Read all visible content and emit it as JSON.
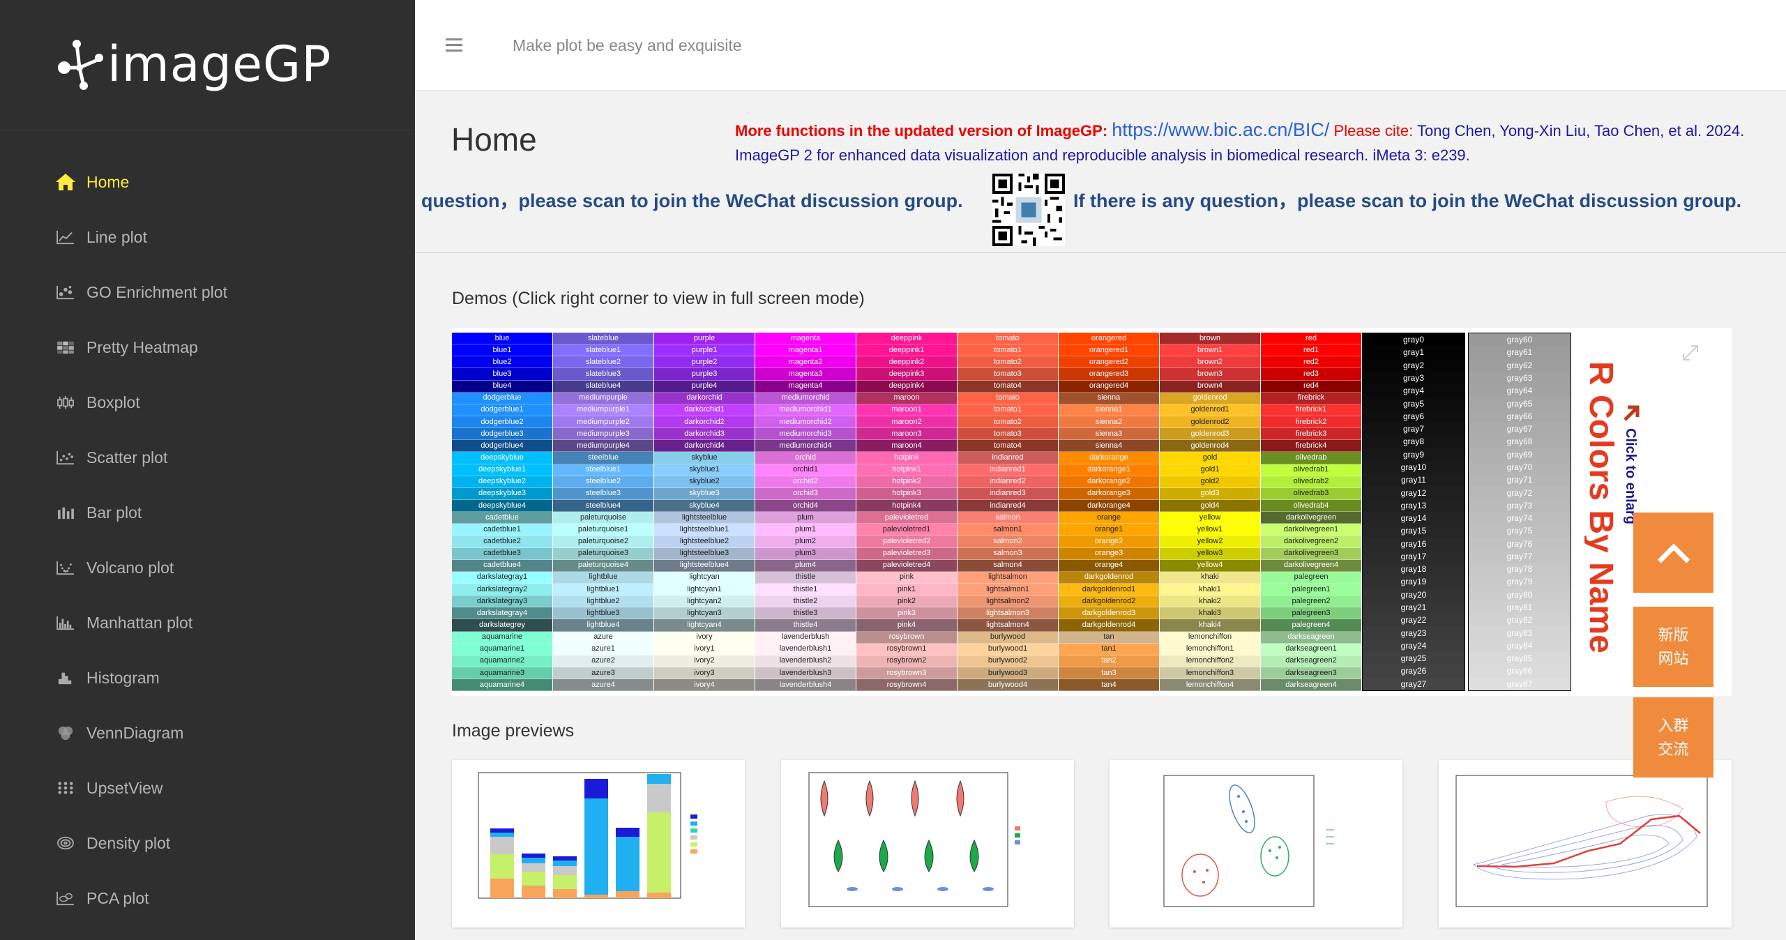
{
  "app": {
    "brand": "imageGP",
    "tagline": "Make plot be easy and exquisite"
  },
  "sidebar": {
    "items": [
      {
        "label": "Home",
        "icon": "home-icon"
      },
      {
        "label": "Line plot",
        "icon": "line-chart-icon"
      },
      {
        "label": "GO Enrichment plot",
        "icon": "go-enrichment-icon"
      },
      {
        "label": "Pretty Heatmap",
        "icon": "heatmap-icon"
      },
      {
        "label": "Boxplot",
        "icon": "boxplot-icon"
      },
      {
        "label": "Scatter plot",
        "icon": "scatter-icon"
      },
      {
        "label": "Bar plot",
        "icon": "bar-chart-icon"
      },
      {
        "label": "Volcano plot",
        "icon": "volcano-icon"
      },
      {
        "label": "Manhattan plot",
        "icon": "manhattan-icon"
      },
      {
        "label": "Histogram",
        "icon": "histogram-icon"
      },
      {
        "label": "VennDiagram",
        "icon": "venn-icon"
      },
      {
        "label": "UpsetView",
        "icon": "upset-icon"
      },
      {
        "label": "Density plot",
        "icon": "density-icon"
      },
      {
        "label": "PCA plot",
        "icon": "pca-icon"
      }
    ]
  },
  "header": {
    "title": "Home",
    "notice_lead": "More functions in the updated version of ImageGP:",
    "notice_url": "https://www.bic.ac.cn/BIC/",
    "cite_label": "Please cite:",
    "citation": "Tong Chen, Yong-Xin Liu, Tao Chen, et al. 2024. ImageGP 2 for enhanced data visualization and reproducible analysis in biomedical research. iMeta 3: e239.",
    "wechat_left": "question，please scan to join the WeChat discussion group.",
    "wechat_right": "If there is any question，please scan to join the WeChat discussion group."
  },
  "demos": {
    "title": "Demos (Click right corner to view in full screen mode)",
    "color_title": "R Colors By Name",
    "click_hint": "Click to enlarg",
    "columns": [
      {
        "names": [
          "blue",
          "blue1",
          "blue2",
          "blue3",
          "blue4",
          "dodgerblue",
          "dodgerblue1",
          "dodgerblue2",
          "dodgerblue3",
          "dodgerblue4",
          "deepskyblue",
          "deepskyblue1",
          "deepskyblue2",
          "deepskyblue3",
          "deepskyblue4",
          "cadetblue",
          "cadetblue1",
          "cadetblue2",
          "cadetblue3",
          "cadetblue4",
          "darkslategray1",
          "darkslategray2",
          "darkslategray3",
          "darkslategray4",
          "darkslategrey",
          "aquamarine",
          "aquamarine1",
          "aquamarine2",
          "aquamarine3",
          "aquamarine4"
        ],
        "colors": [
          "#0000ff",
          "#0000ff",
          "#0000ee",
          "#0000cd",
          "#00008b",
          "#1e90ff",
          "#1e90ff",
          "#1c86ee",
          "#1874cd",
          "#104e8b",
          "#00bfff",
          "#00bfff",
          "#00b2ee",
          "#009acd",
          "#00688b",
          "#5f9ea0",
          "#98f5ff",
          "#8ee5ee",
          "#7ac5cd",
          "#53868b",
          "#97ffff",
          "#8deeee",
          "#79cdcd",
          "#528b8b",
          "#2f4f4f",
          "#7fffd4",
          "#7fffd4",
          "#76eec6",
          "#66cdaa",
          "#458b74"
        ]
      },
      {
        "names": [
          "slateblue",
          "slateblue1",
          "slateblue2",
          "slateblue3",
          "slateblue4",
          "mediumpurple",
          "mediumpurple1",
          "mediumpurple2",
          "mediumpurple3",
          "mediumpurple4",
          "steelblue",
          "steelblue1",
          "steelblue2",
          "steelblue3",
          "steelblue4",
          "paleturquoise",
          "paleturquoise1",
          "paleturquoise2",
          "paleturquoise3",
          "paleturquoise4",
          "lightblue",
          "lightblue1",
          "lightblue2",
          "lightblue3",
          "lightblue4",
          "azure",
          "azure1",
          "azure2",
          "azure3",
          "azure4"
        ],
        "colors": [
          "#6a5acd",
          "#836fff",
          "#7a67ee",
          "#6959cd",
          "#473c8b",
          "#9370db",
          "#ab82ff",
          "#9f79ee",
          "#8968cd",
          "#5d478b",
          "#4682b4",
          "#63b8ff",
          "#5cacee",
          "#4f94cd",
          "#36648b",
          "#afeeee",
          "#bbffff",
          "#aeeeee",
          "#96cdcd",
          "#668b8b",
          "#add8e6",
          "#bfefff",
          "#b2dfee",
          "#9ac0cd",
          "#68838b",
          "#f0ffff",
          "#f0ffff",
          "#e0eeee",
          "#c1cdcd",
          "#838b8b"
        ]
      },
      {
        "names": [
          "purple",
          "purple1",
          "purple2",
          "purple3",
          "purple4",
          "darkorchid",
          "darkorchid1",
          "darkorchid2",
          "darkorchid3",
          "darkorchid4",
          "skyblue",
          "skyblue1",
          "skyblue2",
          "skyblue3",
          "skyblue4",
          "lightsteelblue",
          "lightsteelblue1",
          "lightsteelblue2",
          "lightsteelblue3",
          "lightsteelblue4",
          "lightcyan",
          "lightcyan1",
          "lightcyan2",
          "lightcyan3",
          "lightcyan4",
          "ivory",
          "ivory1",
          "ivory2",
          "ivory3",
          "ivory4"
        ],
        "colors": [
          "#a020f0",
          "#9b30ff",
          "#912cee",
          "#7d26cd",
          "#551a8b",
          "#9932cc",
          "#bf3eff",
          "#b23aee",
          "#9a32cd",
          "#68228b",
          "#87ceeb",
          "#87ceff",
          "#7ec0ee",
          "#6ca6cd",
          "#4a708b",
          "#b0c4de",
          "#cae1ff",
          "#bcd2ee",
          "#a2b5cd",
          "#6e7b8b",
          "#e0ffff",
          "#e0ffff",
          "#d1eeee",
          "#b4cdcd",
          "#7a8b8b",
          "#fffff0",
          "#fffff0",
          "#eeeee0",
          "#cdcdc1",
          "#8b8b83"
        ]
      },
      {
        "names": [
          "magenta",
          "magenta1",
          "magenta2",
          "magenta3",
          "magenta4",
          "mediumorchid",
          "mediumorchid1",
          "mediumorchid2",
          "mediumorchid3",
          "mediumorchid4",
          "orchid",
          "orchid1",
          "orchid2",
          "orchid3",
          "orchid4",
          "plum",
          "plum1",
          "plum2",
          "plum3",
          "plum4",
          "thistle",
          "thistle1",
          "thistle2",
          "thistle3",
          "thistle4",
          "lavenderblush",
          "lavenderblush1",
          "lavenderblush2",
          "lavenderblush3",
          "lavenderblush4"
        ],
        "colors": [
          "#ff00ff",
          "#ff00ff",
          "#ee00ee",
          "#cd00cd",
          "#8b008b",
          "#ba55d3",
          "#e066ff",
          "#d15fee",
          "#b452cd",
          "#7a378b",
          "#da70d6",
          "#ff83fa",
          "#ee7ae9",
          "#cd69c9",
          "#8b4789",
          "#dda0dd",
          "#ffbbff",
          "#eeaeee",
          "#cd96cd",
          "#8b668b",
          "#d8bfd8",
          "#ffe1ff",
          "#eed2ee",
          "#cdb5cd",
          "#8b7b8b",
          "#fff0f5",
          "#fff0f5",
          "#eee0e5",
          "#cdc1c5",
          "#8b8386"
        ]
      },
      {
        "names": [
          "deeppink",
          "deeppink1",
          "deeppink2",
          "deeppink3",
          "deeppink4",
          "maroon",
          "maroon1",
          "maroon2",
          "maroon3",
          "maroon4",
          "hotpink",
          "hotpink1",
          "hotpink2",
          "hotpink3",
          "hotpink4",
          "palevioletred",
          "palevioletred1",
          "palevioletred2",
          "palevioletred3",
          "palevioletred4",
          "pink",
          "pink1",
          "pink2",
          "pink3",
          "pink4",
          "rosybrown",
          "rosybrown1",
          "rosybrown2",
          "rosybrown3",
          "rosybrown4"
        ],
        "colors": [
          "#ff1493",
          "#ff1493",
          "#ee1289",
          "#cd1076",
          "#8b0a50",
          "#b03060",
          "#ff34b3",
          "#ee30a7",
          "#cd2990",
          "#8b1c62",
          "#ff69b4",
          "#ff6eb4",
          "#ee6aa7",
          "#cd6090",
          "#8b3a62",
          "#db7093",
          "#ff82ab",
          "#ee799f",
          "#cd6889",
          "#8b475d",
          "#ffc0cb",
          "#ffb5c5",
          "#eea9b8",
          "#cd919e",
          "#8b636c",
          "#bc8f8f",
          "#ffc1c1",
          "#eeb4b4",
          "#cd9b9b",
          "#8b6969"
        ]
      },
      {
        "names": [
          "tomato",
          "tomato1",
          "tomato2",
          "tomato3",
          "tomato4",
          "tomato",
          "tomato1",
          "tomato2",
          "tomato3",
          "tomato4",
          "indianred",
          "indianred1",
          "indianred2",
          "indianred3",
          "indianred4",
          "salmon",
          "salmon1",
          "salmon2",
          "salmon3",
          "salmon4",
          "lightsalmon",
          "lightsalmon1",
          "lightsalmon2",
          "lightsalmon3",
          "lightsalmon4",
          "burlywood",
          "burlywood1",
          "burlywood2",
          "burlywood3",
          "burlywood4"
        ],
        "colors": [
          "#ff6347",
          "#ff6347",
          "#ee5c42",
          "#cd4f39",
          "#8b3626",
          "#ff6347",
          "#ff6347",
          "#ee5c42",
          "#cd4f39",
          "#8b3626",
          "#cd5c5c",
          "#ff6a6a",
          "#ee6363",
          "#cd5555",
          "#8b3a3a",
          "#fa8072",
          "#ff8c69",
          "#ee8262",
          "#cd7054",
          "#8b4c39",
          "#ffa07a",
          "#ffa07a",
          "#ee9572",
          "#cd8162",
          "#8b5742",
          "#deb887",
          "#ffd39b",
          "#eec591",
          "#cdaa7d",
          "#8b7355"
        ]
      },
      {
        "names": [
          "orangered",
          "orangered1",
          "orangered2",
          "orangered3",
          "orangered4",
          "sienna",
          "sienna1",
          "sienna2",
          "sienna3",
          "sienna4",
          "darkorange",
          "darkorange1",
          "darkorange2",
          "darkorange3",
          "darkorange4",
          "orange",
          "orange1",
          "orange2",
          "orange3",
          "orange4",
          "darkgoldenrod",
          "darkgoldenrod1",
          "darkgoldenrod2",
          "darkgoldenrod3",
          "darkgoldenrod4",
          "tan",
          "tan1",
          "tan2",
          "tan3",
          "tan4"
        ],
        "colors": [
          "#ff4500",
          "#ff4500",
          "#ee4000",
          "#cd3700",
          "#8b2500",
          "#a0522d",
          "#ff8247",
          "#ee7942",
          "#cd6839",
          "#8b4726",
          "#ff8c00",
          "#ff7f00",
          "#ee7600",
          "#cd6600",
          "#8b4500",
          "#ffa500",
          "#ffa500",
          "#ee9a00",
          "#cd8500",
          "#8b5a00",
          "#b8860b",
          "#ffb90f",
          "#eead0e",
          "#cd950c",
          "#8b6508",
          "#d2b48c",
          "#ffa54f",
          "#ee9a49",
          "#cd853f",
          "#8b5a2b"
        ]
      },
      {
        "names": [
          "brown",
          "brown1",
          "brown2",
          "brown3",
          "brown4",
          "goldenrod",
          "goldenrod1",
          "goldenrod2",
          "goldenrod3",
          "goldenrod4",
          "gold",
          "gold1",
          "gold2",
          "gold3",
          "gold4",
          "yellow",
          "yellow1",
          "yellow2",
          "yellow3",
          "yellow4",
          "khaki",
          "khaki1",
          "khaki2",
          "khaki3",
          "khaki4",
          "lemonchiffon",
          "lemonchiffon1",
          "lemonchiffon2",
          "lemonchiffon3",
          "lemonchiffon4"
        ],
        "colors": [
          "#a52a2a",
          "#ff4040",
          "#ee3b3b",
          "#cd3333",
          "#8b2323",
          "#daa520",
          "#ffc125",
          "#eeb422",
          "#cd9b1d",
          "#8b6914",
          "#ffd700",
          "#ffd700",
          "#eec900",
          "#cdad00",
          "#8b7500",
          "#ffff00",
          "#ffff00",
          "#eeee00",
          "#cdcd00",
          "#8b8b00",
          "#f0e68c",
          "#fff68f",
          "#eee685",
          "#cdc673",
          "#8b864e",
          "#fffacd",
          "#fffacd",
          "#eee9bf",
          "#cdc9a5",
          "#8b8970"
        ]
      },
      {
        "names": [
          "red",
          "red1",
          "red2",
          "red3",
          "red4",
          "firebrick",
          "firebrick1",
          "firebrick2",
          "firebrick3",
          "firebrick4",
          "olivedrab",
          "olivedrab1",
          "olivedrab2",
          "olivedrab3",
          "olivedrab4",
          "darkolivegreen",
          "darkolivegreen1",
          "darkolivegreen2",
          "darkolivegreen3",
          "darkolivegreen4",
          "palegreen",
          "palegreen1",
          "palegreen2",
          "palegreen3",
          "palegreen4",
          "darkseagreen",
          "darkseagreen1",
          "darkseagreen2",
          "darkseagreen3",
          "darkseagreen4"
        ],
        "colors": [
          "#ff0000",
          "#ff0000",
          "#ee0000",
          "#cd0000",
          "#8b0000",
          "#b22222",
          "#ff3030",
          "#ee2c2c",
          "#cd2626",
          "#8b1a1a",
          "#6b8e23",
          "#c0ff3e",
          "#b3ee3a",
          "#9acd32",
          "#698b22",
          "#556b2f",
          "#caff70",
          "#bcee68",
          "#a2cd5a",
          "#6e8b3d",
          "#98fb98",
          "#9aff9a",
          "#90ee90",
          "#7ccd7c",
          "#548b54",
          "#8fbc8f",
          "#c1ffc1",
          "#b4eeb4",
          "#9bcd9b",
          "#698b69"
        ]
      }
    ],
    "gray_columns": [
      {
        "names": [
          "gray0",
          "gray1",
          "gray2",
          "gray3",
          "gray4",
          "gray5",
          "gray6",
          "gray7",
          "gray8",
          "gray9",
          "gray10",
          "gray11",
          "gray12",
          "gray13",
          "gray14",
          "gray15",
          "gray16",
          "gray17",
          "gray18",
          "gray19",
          "gray20",
          "gray21",
          "gray22",
          "gray23",
          "gray24",
          "gray25",
          "gray26",
          "gray27"
        ],
        "colors": [
          "#000000",
          "#030303",
          "#050505",
          "#080808",
          "#0a0a0a",
          "#0d0d0d",
          "#0f0f0f",
          "#121212",
          "#141414",
          "#171717",
          "#1a1a1a",
          "#1c1c1c",
          "#1f1f1f",
          "#212121",
          "#242424",
          "#262626",
          "#292929",
          "#2b2b2b",
          "#2e2e2e",
          "#303030",
          "#333333",
          "#363636",
          "#383838",
          "#3b3b3b",
          "#3d3d3d",
          "#404040",
          "#424242",
          "#454545"
        ]
      },
      {
        "names": [
          "gray60",
          "gray61",
          "gray62",
          "gray63",
          "gray64",
          "gray65",
          "gray66",
          "gray67",
          "gray68",
          "gray69",
          "gray70",
          "gray71",
          "gray72",
          "gray73",
          "gray74",
          "gray75",
          "gray76",
          "gray77",
          "gray78",
          "gray79",
          "gray80",
          "gray81",
          "gray82",
          "gray83",
          "gray84",
          "gray85",
          "gray86",
          "gray87"
        ],
        "colors": [
          "#999999",
          "#9c9c9c",
          "#9e9e9e",
          "#a1a1a1",
          "#a3a3a3",
          "#a6a6a6",
          "#a8a8a8",
          "#ababab",
          "#adadad",
          "#b0b0b0",
          "#b3b3b3",
          "#b5b5b5",
          "#b8b8b8",
          "#bababa",
          "#bdbdbd",
          "#bfbfbf",
          "#c2c2c2",
          "#c4c4c4",
          "#c7c7c7",
          "#c9c9c9",
          "#cccccc",
          "#cfcfcf",
          "#d1d1d1",
          "#d4d4d4",
          "#d6d6d6",
          "#d9d9d9",
          "#dbdbdb",
          "#dedede"
        ]
      }
    ]
  },
  "previews": {
    "title": "Image previews"
  },
  "floating": {
    "top_icon": "arrow-up-icon",
    "new_site": "新版\n网站",
    "join_group": "入群\n交流"
  },
  "colors": {
    "sidebar_bg": "#2f2f2f",
    "active": "#ffeb3b",
    "accent": "#f08a3c"
  }
}
